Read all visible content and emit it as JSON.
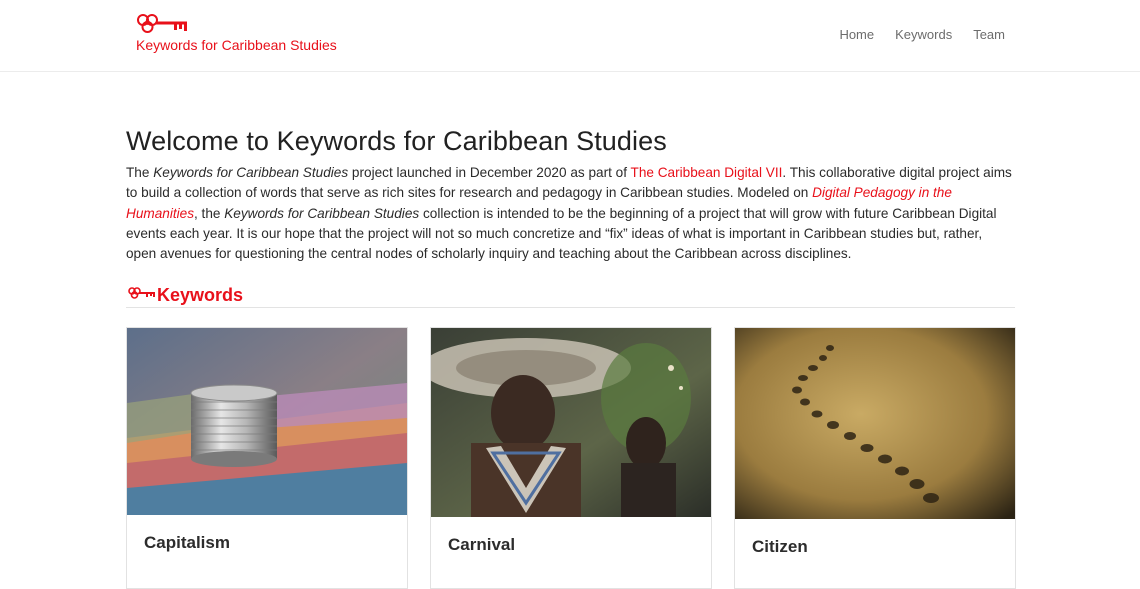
{
  "site": {
    "brand_name": "Keywords for Caribbean Studies",
    "brand_color": "#e8101a"
  },
  "nav": {
    "items": [
      {
        "label": "Home"
      },
      {
        "label": "Keywords"
      },
      {
        "label": "Team"
      }
    ]
  },
  "main": {
    "title": "Welcome to Keywords for Caribbean Studies",
    "intro": {
      "p1": "The ",
      "em1": "Keywords for Caribbean Studies",
      "p2": " project launched in December 2020 as part of ",
      "link1": "The Caribbean Digital VII",
      "p3": ". This collaborative digital project aims to build a collection of words that serve as rich sites for research and pedagogy in Caribbean studies. Modeled on ",
      "link2": "Digital Pedagogy in the Humanities",
      "p4": ", the ",
      "em2": "Keywords for Caribbean Studies",
      "p5": " collection is intended to be the beginning of a project that will grow with future Caribbean Digital events each year. It is our hope that the project will not so much concretize and “fix” ideas of what is important in Caribbean studies but, rather, open avenues for questioning the central nodes of scholarly inquiry and teaching about the Caribbean across disciplines."
    }
  },
  "keywords_section": {
    "heading": "Keywords",
    "cards": [
      {
        "title": "Capitalism",
        "image": "coins-on-banknotes-photo"
      },
      {
        "title": "Carnival",
        "image": "carnival-masquerader-photo"
      },
      {
        "title": "Citizen",
        "image": "footprints-in-sand-photo"
      }
    ]
  }
}
